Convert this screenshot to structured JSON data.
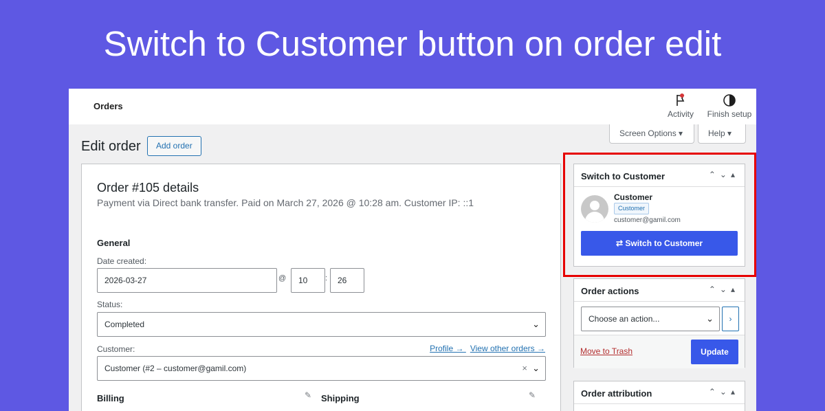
{
  "banner": {
    "title": "Switch to Customer button on order edit"
  },
  "topbar": {
    "page_name": "Orders",
    "activity_label": "Activity",
    "finish_setup_label": "Finish setup"
  },
  "screen_options": {
    "screen_options_label": "Screen Options ▾",
    "help_label": "Help ▾"
  },
  "header": {
    "title": "Edit order",
    "add_order_label": "Add order"
  },
  "order": {
    "title": "Order #105 details",
    "subtitle": "Payment via Direct bank transfer. Paid on March 27, 2026 @ 10:28 am. Customer IP: ::1",
    "general_heading": "General",
    "date_created_label": "Date created:",
    "date_value": "2026-03-27",
    "at_symbol": "@",
    "colon_symbol": ":",
    "hour_value": "10",
    "minute_value": "26",
    "status_label": "Status:",
    "status_value": "Completed",
    "customer_label": "Customer:",
    "profile_link": "Profile →",
    "view_other_orders_link": "View other orders →",
    "customer_value": "Customer (#2 – customer@gamil.com)",
    "clear_symbol": "×",
    "billing_heading": "Billing",
    "shipping_heading": "Shipping"
  },
  "switch_panel": {
    "title": "Switch to Customer",
    "customer_name": "Customer",
    "customer_role": "Customer",
    "customer_email": "customer@gamil.com",
    "button_label": "Switch to Customer"
  },
  "order_actions": {
    "title": "Order actions",
    "select_value": "Choose an action...",
    "trash_label": "Move to Trash",
    "update_label": "Update"
  },
  "attribution": {
    "title": "Order attribution"
  },
  "colors": {
    "background": "#5e58e3",
    "primary": "#3858e9",
    "highlight": "#e60000",
    "link": "#2271b1"
  }
}
